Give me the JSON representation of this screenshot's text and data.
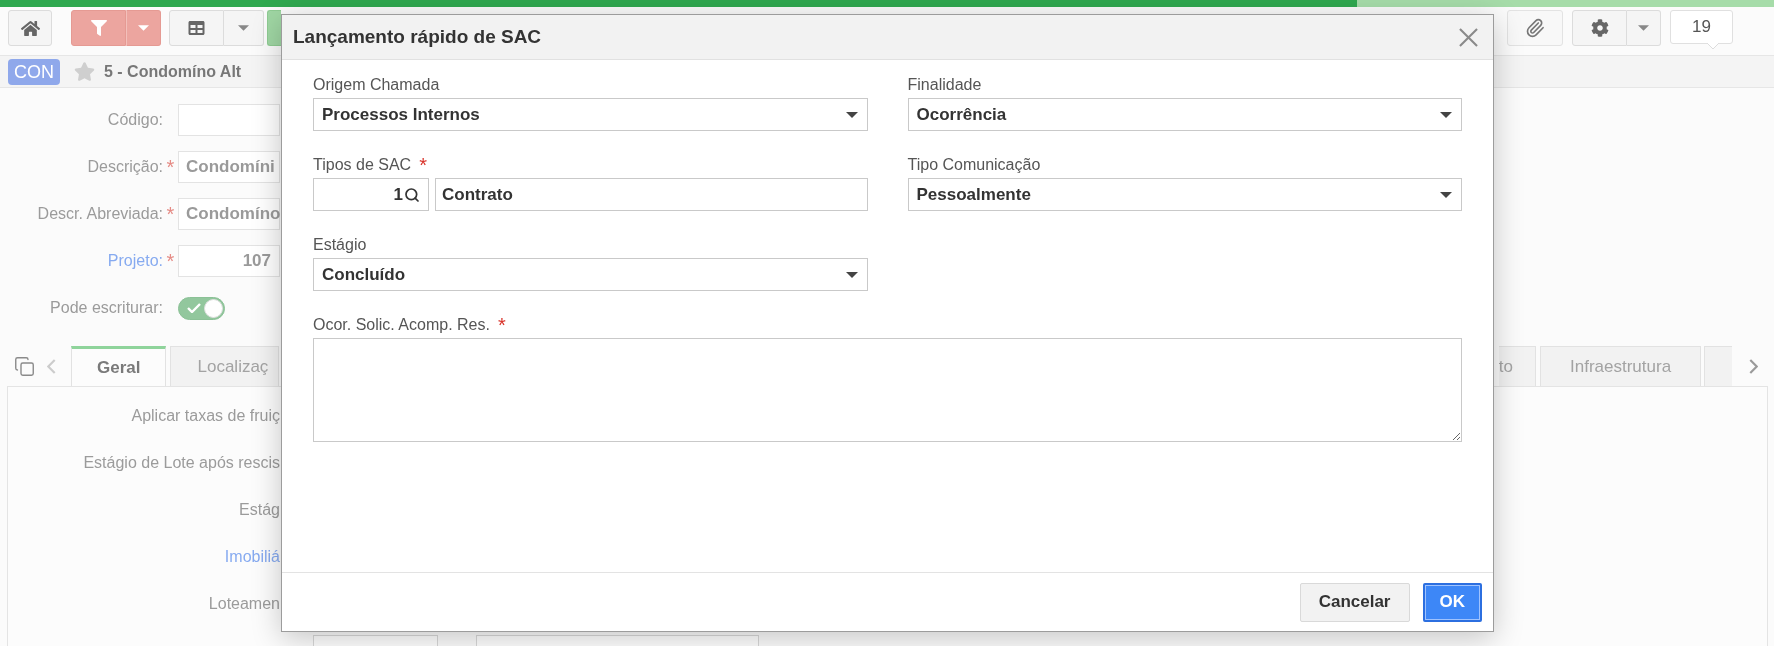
{
  "progress": {
    "level": 0.765
  },
  "toolbar": {
    "filter_active": true,
    "notification_count": "19"
  },
  "record_header": {
    "badge": "CON",
    "favorite": false,
    "title": "5 - Condomíno Alt"
  },
  "form": {
    "rows": [
      {
        "kind": "input",
        "label": "Código:",
        "link": false
      },
      {
        "kind": "input",
        "label": "Descrição:",
        "link": false,
        "mark": "*",
        "value": "Condomíni"
      },
      {
        "kind": "input",
        "label": "Descr. Abreviada:",
        "link": false,
        "mark": "*",
        "value": "Condomíno"
      },
      {
        "kind": "number",
        "label": "Projeto:",
        "link": true,
        "mark": "*",
        "value": "107"
      },
      {
        "kind": "toggle",
        "label": "Pode escriturar:",
        "link": false,
        "on": true
      }
    ]
  },
  "tabs": [
    {
      "label": "Geral",
      "selected": true
    },
    {
      "label": "Localizaç",
      "selected": false
    },
    {
      "label": "to",
      "selected": false
    },
    {
      "label": "Infraestrutura",
      "selected": false
    },
    {
      "selected": false
    }
  ],
  "panel": {
    "rows": [
      {
        "label": "Aplicar taxas de fruiç",
        "link": false
      },
      {
        "label": "Estágio de Lote após rescis",
        "link": false
      },
      {
        "label": "Estág",
        "link": false
      },
      {
        "label": "Imobiliá",
        "link": true
      },
      {
        "label": "Loteamen",
        "link": false
      }
    ]
  },
  "dialog": {
    "title": "Lançamento rápido de SAC",
    "fields": [
      {
        "kind": "select",
        "label": "Origem Chamada",
        "value": "Processos Internos"
      },
      {
        "kind": "select",
        "label": "Finalidade",
        "value": "Ocorrência"
      },
      {
        "kind": "lookup",
        "label": "Tipos de SAC",
        "mark": "*",
        "code": "1",
        "value": "Contrato"
      },
      {
        "kind": "select",
        "label": "Tipo Comunicação",
        "value": "Pessoalmente"
      },
      {
        "kind": "select",
        "label": "Estágio",
        "value": "Concluído"
      },
      {
        "kind": "textarea",
        "label": "Ocor. Solic. Acomp. Res.",
        "mark": "*"
      }
    ],
    "buttons": [
      {
        "label": "Cancelar",
        "primary": false
      },
      {
        "label": "OK",
        "primary": true
      }
    ]
  }
}
